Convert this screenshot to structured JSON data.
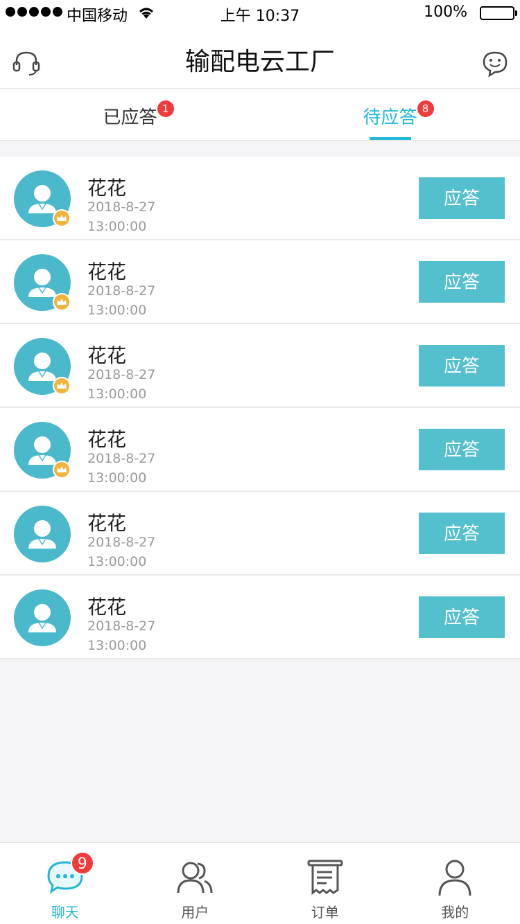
{
  "status_bar": {
    "carrier": "中国移动",
    "time": "上午 10:37",
    "battery": "100%"
  },
  "nav": {
    "title": "输配电云工厂",
    "left_icon": "headset-icon",
    "right_icon": "chat-bubble-icon"
  },
  "tabs": [
    {
      "label": "已应答",
      "badge": "1",
      "active": false
    },
    {
      "label": "待应答",
      "badge": "8",
      "active": true
    }
  ],
  "list": {
    "items": [
      {
        "name": "花花",
        "date": "2018-8-27",
        "time": "13:00:00",
        "button": "应答",
        "crown": true
      },
      {
        "name": "花花",
        "date": "2018-8-27",
        "time": "13:00:00",
        "button": "应答",
        "crown": true
      },
      {
        "name": "花花",
        "date": "2018-8-27",
        "time": "13:00:00",
        "button": "应答",
        "crown": true
      },
      {
        "name": "花花",
        "date": "2018-8-27",
        "time": "13:00:00",
        "button": "应答",
        "crown": true
      },
      {
        "name": "花花",
        "date": "2018-8-27",
        "time": "13:00:00",
        "button": "应答",
        "crown": false
      },
      {
        "name": "花花",
        "date": "2018-8-27",
        "time": "13:00:00",
        "button": "应答",
        "crown": false
      }
    ]
  },
  "tab_bar": [
    {
      "label": "聊天",
      "icon": "chat-icon",
      "badge": "9",
      "active": true
    },
    {
      "label": "用户",
      "icon": "users-icon",
      "badge": "",
      "active": false
    },
    {
      "label": "订单",
      "icon": "receipt-icon",
      "badge": "",
      "active": false
    },
    {
      "label": "我的",
      "icon": "person-icon",
      "badge": "",
      "active": false
    }
  ],
  "colors": {
    "accent": "#21b8d8",
    "button": "#54bfcd",
    "badge": "#ef3b3b",
    "crown": "#f0b43c"
  }
}
